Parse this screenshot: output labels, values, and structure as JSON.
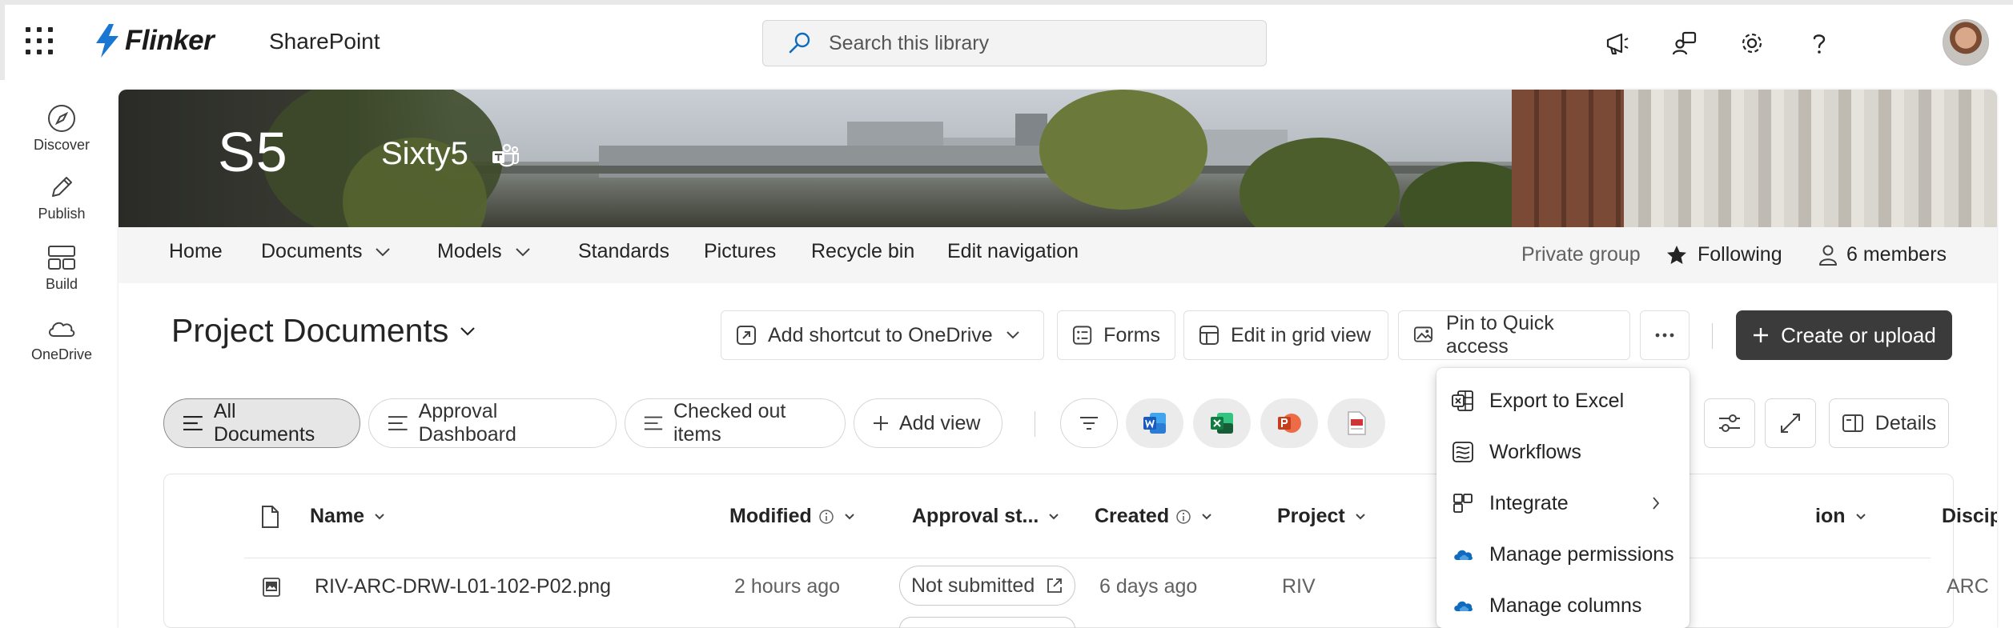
{
  "suite": {
    "brand": "Flinker",
    "app": "SharePoint",
    "search_placeholder": "Search this library"
  },
  "rail": [
    {
      "label": "Discover"
    },
    {
      "label": "Publish"
    },
    {
      "label": "Build"
    },
    {
      "label": "OneDrive"
    }
  ],
  "site": {
    "logo": "S5",
    "title": "Sixty5"
  },
  "nav": {
    "home": "Home",
    "documents": "Documents",
    "models": "Models",
    "standards": "Standards",
    "pictures": "Pictures",
    "recycle": "Recycle bin",
    "edit": "Edit navigation",
    "private": "Private group",
    "following": "Following",
    "members": "6 members"
  },
  "library": {
    "title": "Project Documents"
  },
  "commands": {
    "shortcut": "Add shortcut to OneDrive",
    "forms": "Forms",
    "grid": "Edit in grid view",
    "pin": "Pin to Quick access",
    "create": "Create or upload"
  },
  "views": {
    "all": "All Documents",
    "approval": "Approval Dashboard",
    "checked": "Checked out items",
    "add": "Add view",
    "details": "Details"
  },
  "columns": {
    "name": "Name",
    "modified": "Modified",
    "approval": "Approval st...",
    "created": "Created",
    "project": "Project",
    "partial": "ion",
    "discipline": "Discipline"
  },
  "rows": [
    {
      "name": "RIV-ARC-DRW-L01-102-P02.png",
      "modified": "2 hours ago",
      "status": "Not submitted",
      "created": "6 days ago",
      "project": "RIV",
      "discipline": "ARC"
    }
  ],
  "menu": {
    "export": "Export to Excel",
    "workflows": "Workflows",
    "integrate": "Integrate",
    "permissions": "Manage permissions",
    "columns": "Manage columns"
  },
  "colors": {
    "accent": "#0f6cbd",
    "brand_bolt": "#1976d2",
    "create_button": "#3b3b3b",
    "word": "#185abd",
    "excel": "#107c41",
    "powerpoint": "#c43e1c"
  }
}
